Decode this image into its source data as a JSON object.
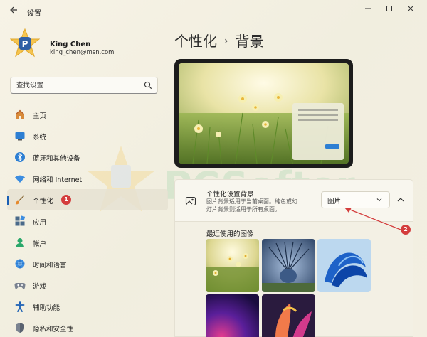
{
  "window": {
    "title": "设置",
    "back_icon": "arrow-left-icon",
    "controls": [
      "minimize-icon",
      "maximize-icon",
      "close-icon"
    ]
  },
  "profile": {
    "name": "King Chen",
    "email": "king_chen@msn.com"
  },
  "search": {
    "placeholder": "查找设置"
  },
  "nav": {
    "items": [
      {
        "label": "主页",
        "icon": "home-icon"
      },
      {
        "label": "系统",
        "icon": "system-icon"
      },
      {
        "label": "蓝牙和其他设备",
        "icon": "bluetooth-icon"
      },
      {
        "label": "网络和 Internet",
        "icon": "wifi-icon"
      },
      {
        "label": "个性化",
        "icon": "brush-icon",
        "active": true,
        "badge": "1"
      },
      {
        "label": "应用",
        "icon": "apps-icon"
      },
      {
        "label": "帐户",
        "icon": "account-icon"
      },
      {
        "label": "时间和语言",
        "icon": "globe-icon"
      },
      {
        "label": "游戏",
        "icon": "gamepad-icon"
      },
      {
        "label": "辅助功能",
        "icon": "accessibility-icon"
      },
      {
        "label": "隐私和安全性",
        "icon": "shield-icon"
      }
    ]
  },
  "breadcrumb": {
    "parent": "个性化",
    "separator": "›",
    "current": "背景"
  },
  "background_card": {
    "title": "个性化设置背景",
    "description": "图片背景适用于当前桌面。纯色或幻灯片背景则适用于所有桌面。",
    "dropdown_value": "图片"
  },
  "recent": {
    "label": "最近使用的图像"
  },
  "watermark": {
    "text": "PCSofter"
  },
  "annotations": {
    "marker_2": "2"
  },
  "colors": {
    "accent": "#1a5fb4",
    "badge": "#d43d3d"
  }
}
